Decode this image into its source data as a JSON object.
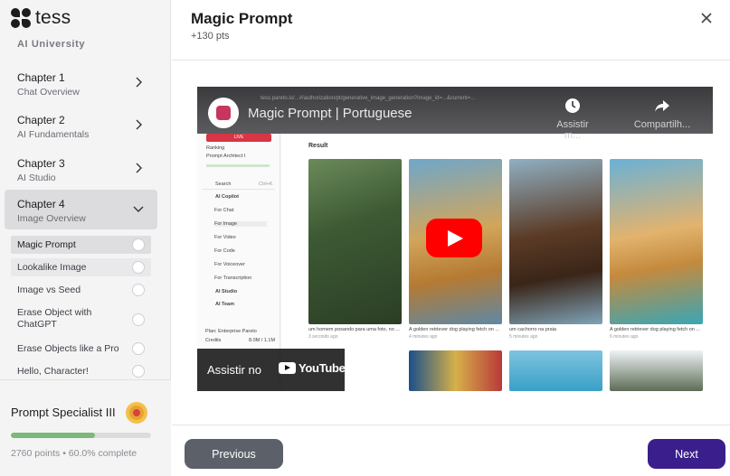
{
  "brand": {
    "name": "tess",
    "section": "AI University"
  },
  "sidebar": {
    "chapters": [
      {
        "title": "Chapter 1",
        "subtitle": "Chat Overview",
        "icon": "chevron-right-icon"
      },
      {
        "title": "Chapter 2",
        "subtitle": "AI Fundamentals",
        "icon": "chevron-right-icon"
      },
      {
        "title": "Chapter 3",
        "subtitle": "AI Studio",
        "icon": "chevron-right-icon"
      },
      {
        "title": "Chapter 4",
        "subtitle": "Image Overview",
        "icon": "chevron-down-icon"
      }
    ],
    "lessons": [
      {
        "label": "Magic Prompt",
        "active": true
      },
      {
        "label": "Lookalike Image"
      },
      {
        "label": "Image vs Seed"
      },
      {
        "label": "Erase Object with ChatGPT"
      },
      {
        "label": "Erase Objects like a Pro"
      },
      {
        "label": "Hello, Character!"
      }
    ],
    "footer": {
      "rank": "Prompt Specialist III",
      "progress_fraction": 0.6,
      "stats": "2760 points • 60.0% complete",
      "medal_icon": "medal-icon"
    }
  },
  "header": {
    "title": "Magic Prompt",
    "points": "+130 pts",
    "close_icon": "close-icon"
  },
  "video": {
    "title": "Magic Prompt | Portuguese",
    "watch_later": "Assistir m...",
    "share": "Compartilh...",
    "watch_on": "Assistir no",
    "youtube": "YouTube",
    "url": "tess.pareto.io/...#/authorization/pt/generative_image_generation?image_id=...&current=...",
    "sidebar": {
      "live": "LIVE",
      "ranking": "Ranking",
      "rank_value": "Prompt Architect I",
      "search": "Search",
      "search_shortcut": "Ctrl+K",
      "copilot": "AI Copilot",
      "items": [
        "For Chat",
        "For Image",
        "For Video",
        "For Code",
        "For Voiceover",
        "For Transcription"
      ],
      "studio": "AI Studio",
      "team": "AI Team",
      "plan": "Plan: Enterprise Pareto",
      "credits": "Credits",
      "credits_value": "8.0M / 1.1M"
    },
    "result_label": "Result",
    "captions": [
      {
        "text": "um homem posando para uma foto, no ...",
        "time": "3 seconds ago"
      },
      {
        "text": "A golden retriever dog playing fetch on ...",
        "time": "4 minutes ago"
      },
      {
        "text": "um cachorro na praia",
        "time": "5 minutes ago"
      },
      {
        "text": "A golden retriever dog playing fetch on ...",
        "time": "6 minutes ago"
      }
    ]
  },
  "footer": {
    "previous": "Previous",
    "next": "Next"
  },
  "colors": {
    "next_button": "#3a1f8c",
    "prev_button": "#5b6069",
    "progress": "#7cb87a",
    "play": "#ff0000"
  }
}
